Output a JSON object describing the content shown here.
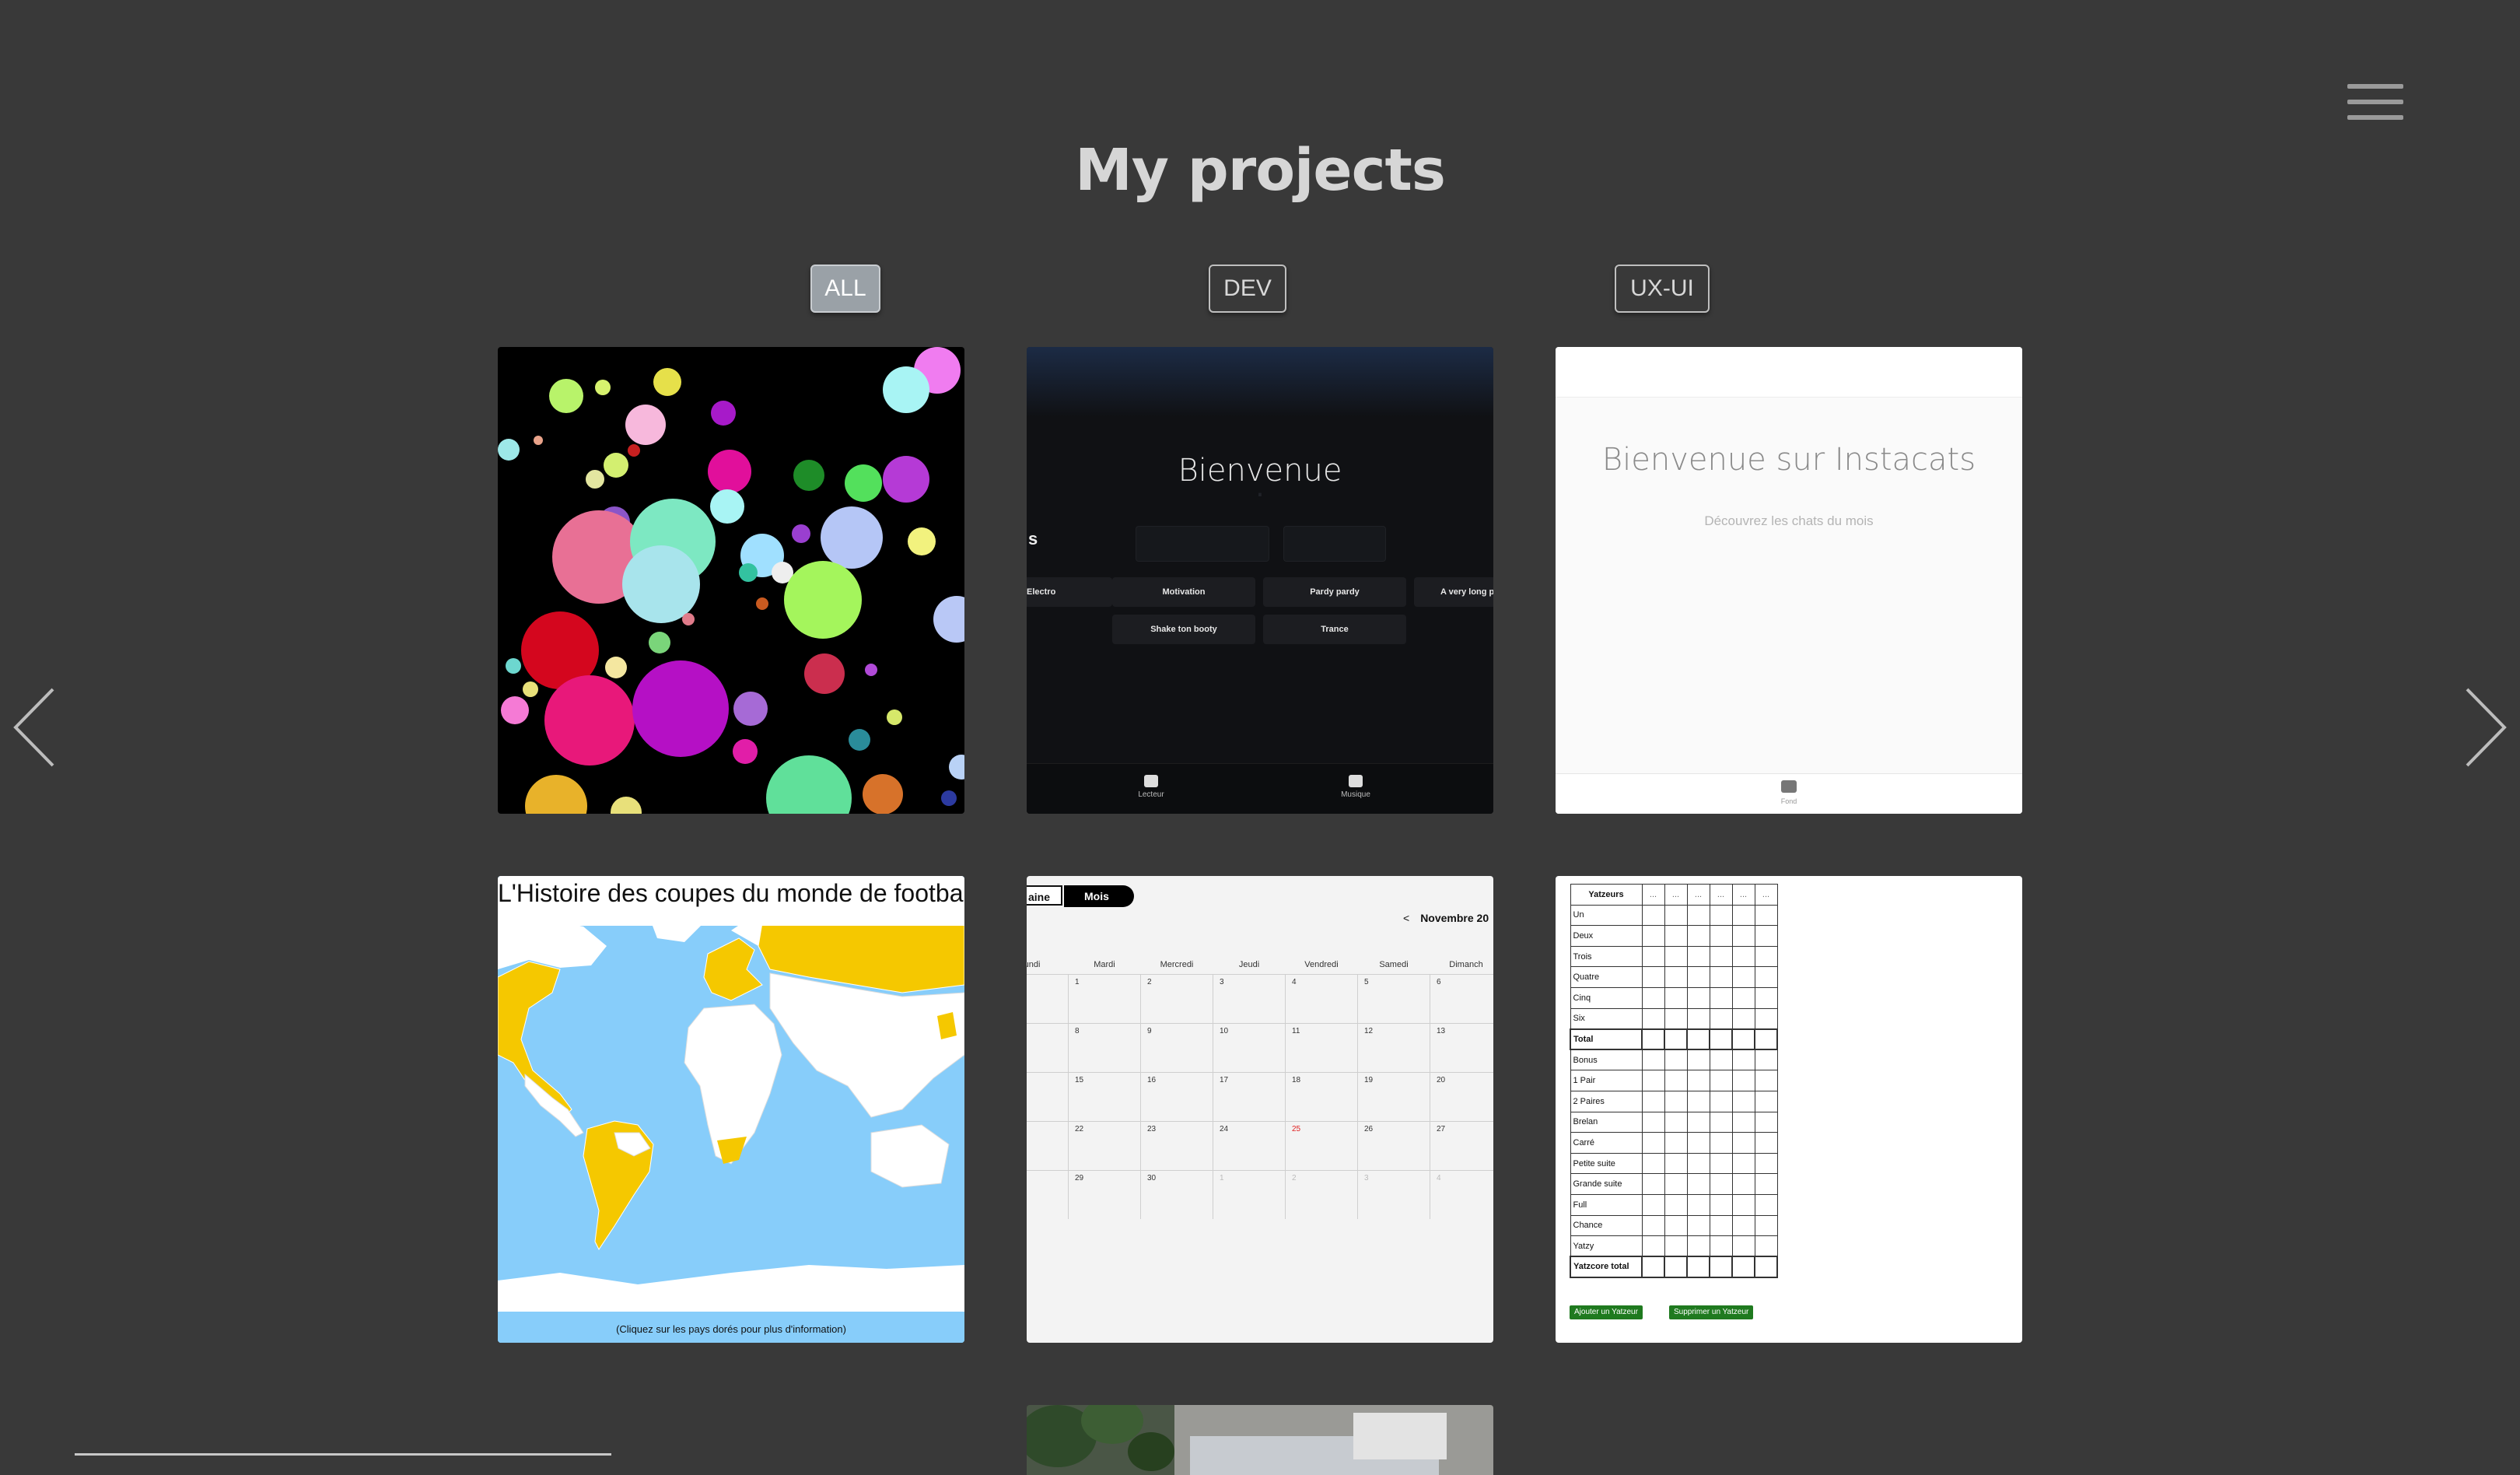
{
  "header": {
    "title": "My projects"
  },
  "filters": [
    {
      "label": "ALL",
      "active": true
    },
    {
      "label": "DEV",
      "active": false
    },
    {
      "label": "UX-UI",
      "active": false
    }
  ],
  "cards": {
    "music": {
      "welcome": "Bienvenue",
      "section_letter": "s",
      "tiles_row1": [
        "Electro",
        "Motivation",
        "Pardy pardy",
        "A very long pla"
      ],
      "tiles_row2": [
        "Shake ton booty",
        "Trance"
      ],
      "footer": [
        "Lecteur",
        "Musique"
      ]
    },
    "instacats": {
      "heading": "Bienvenue sur Instacats",
      "subheading": "Découvrez les chats du mois",
      "footer_label": "Fond"
    },
    "worldcup": {
      "heading": "L'Histoire des coupes du monde de footbal",
      "footer": "(Cliquez sur les pays dorés pour plus d'information)",
      "colors": {
        "ocean": "#87cdfa",
        "winner": "#f5c800",
        "land": "#ffffff"
      }
    },
    "calendar": {
      "tab_week": "aine",
      "tab_month": "Mois",
      "month_prev": "<",
      "month_label": "Novembre 20",
      "days": [
        "undi",
        "Mardi",
        "Mercredi",
        "Jeudi",
        "Vendredi",
        "Samedi",
        "Dimanch"
      ],
      "weeks": [
        [
          "",
          "1",
          "2",
          "3",
          "4",
          "5",
          "6"
        ],
        [
          "",
          "8",
          "9",
          "10",
          "11",
          "12",
          "13"
        ],
        [
          "",
          "15",
          "16",
          "17",
          "18",
          "19",
          "20"
        ],
        [
          "",
          "22",
          "23",
          "24",
          "25",
          "26",
          "27"
        ],
        [
          "",
          "29",
          "30",
          "1",
          "2",
          "3",
          "4"
        ]
      ],
      "highlight_day": "25"
    },
    "yatzy": {
      "header": "Yatzeurs",
      "player_placeholder": "...",
      "rows": [
        "Un",
        "Deux",
        "Trois",
        "Quatre",
        "Cinq",
        "Six",
        "Total",
        "Bonus",
        "1 Pair",
        "2 Paires",
        "Brelan",
        "Carré",
        "Petite suite",
        "Grande suite",
        "Full",
        "Chance",
        "Yatzy",
        "Yatzcore total"
      ],
      "add_button": "Ajouter un Yatzeur",
      "remove_button": "Supprimer un Yatzeur"
    }
  },
  "icons": {
    "menu": "hamburger-icon",
    "prev": "chevron-left-icon",
    "next": "chevron-right-icon"
  }
}
